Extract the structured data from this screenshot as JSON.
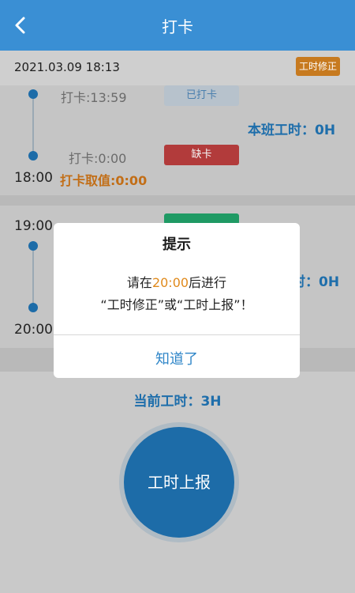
{
  "header": {
    "title": "打卡"
  },
  "info": {
    "datetime": "2021.03.09 18:13",
    "fix_button": "工时修正"
  },
  "shift1": {
    "punch1": "打卡:13:59",
    "punch1_tag": "已打卡",
    "shift_hours": "本班工时：0H",
    "punch2": "打卡:0:00",
    "punch2_tag": "缺卡",
    "end_time": "18:00",
    "punch_value": "打卡取值:0:00"
  },
  "shift2": {
    "start_time": "19:00",
    "shift_hours_partial": "时：0H",
    "end_time": "20:00"
  },
  "summary": {
    "current_hours": "当前工时：3H",
    "report_button": "工时上报"
  },
  "dialog": {
    "title": "提示",
    "line1_prefix": "请在",
    "line1_time": "20:00",
    "line1_suffix": "后进行",
    "line2": "“工时修正”或“工时上报”！",
    "ok": "知道了"
  },
  "colors": {
    "primary": "#3a8fd4",
    "accent_orange": "#e08a1c",
    "missing_red": "#b23b3b",
    "green": "#1f9a64"
  }
}
